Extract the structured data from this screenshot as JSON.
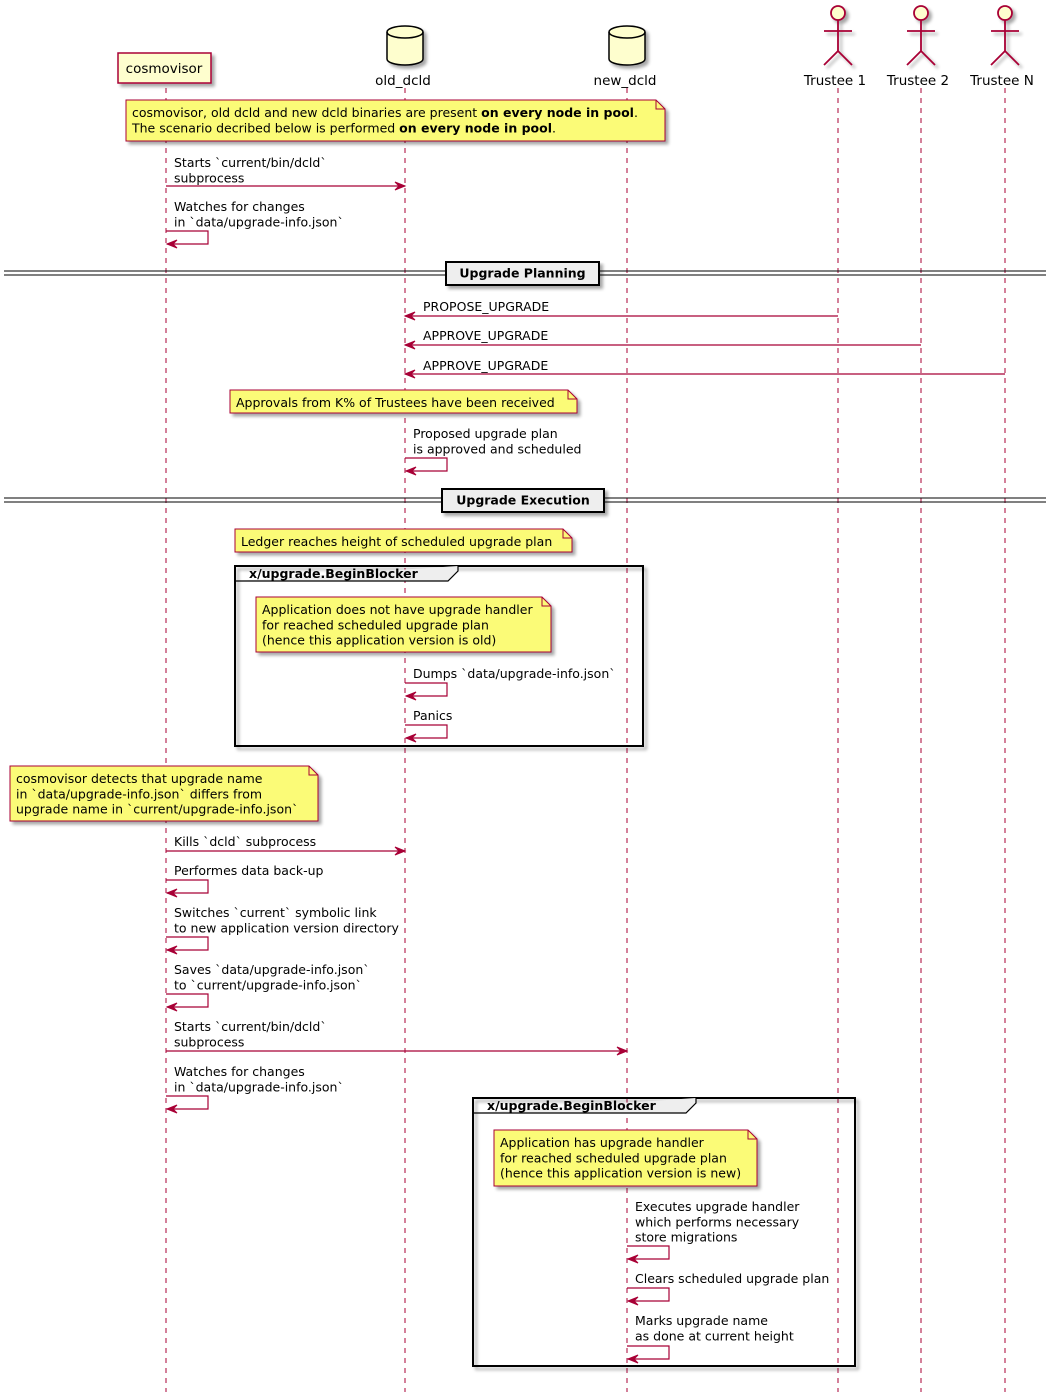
{
  "colors": {
    "line": "#A80036",
    "participant_fill": "#FEFECE",
    "note_fill": "#FBFB77",
    "divider_fill": "#EEEEEE"
  },
  "participants": [
    {
      "label": "cosmovisor",
      "kind": "participant"
    },
    {
      "label": "old_dcld",
      "kind": "database"
    },
    {
      "label": "new_dcld",
      "kind": "database"
    },
    {
      "label": "Trustee 1",
      "kind": "actor"
    },
    {
      "label": "Trustee 2",
      "kind": "actor"
    },
    {
      "label": "Trustee N",
      "kind": "actor"
    }
  ],
  "notes": [
    {
      "lines": [
        [
          {
            "text": "cosmovisor, old dcld and new dcld binaries are present ",
            "bold": false
          },
          {
            "text": "on every node in pool",
            "bold": true
          },
          {
            "text": ".",
            "bold": false
          }
        ],
        [
          {
            "text": "The scenario decribed below is performed ",
            "bold": false
          },
          {
            "text": "on every node in pool",
            "bold": true
          },
          {
            "text": ".",
            "bold": false
          }
        ]
      ]
    },
    {
      "lines": [
        [
          {
            "text": "Approvals from K% of Trustees have been received",
            "bold": false
          }
        ]
      ]
    },
    {
      "lines": [
        [
          {
            "text": "Ledger reaches height of scheduled upgrade plan",
            "bold": false
          }
        ]
      ]
    },
    {
      "lines": [
        [
          {
            "text": "Application does not have upgrade handler",
            "bold": false
          }
        ],
        [
          {
            "text": "for reached scheduled upgrade plan",
            "bold": false
          }
        ],
        [
          {
            "text": "(hence this application version is old)",
            "bold": false
          }
        ]
      ]
    },
    {
      "lines": [
        [
          {
            "text": "cosmovisor detects that upgrade name",
            "bold": false
          }
        ],
        [
          {
            "text": "in `data/upgrade-info.json` differs from",
            "bold": false
          }
        ],
        [
          {
            "text": "upgrade name in `current/upgrade-info.json`",
            "bold": false
          }
        ]
      ]
    },
    {
      "lines": [
        [
          {
            "text": "Application has upgrade handler",
            "bold": false
          }
        ],
        [
          {
            "text": "for reached scheduled upgrade plan",
            "bold": false
          }
        ],
        [
          {
            "text": "(hence this application version is new)",
            "bold": false
          }
        ]
      ]
    }
  ],
  "messages": [
    {
      "from": "cosmovisor",
      "to": "old_dcld",
      "lines": [
        "Starts `current/bin/dcld`",
        "subprocess"
      ]
    },
    {
      "from": "cosmovisor",
      "to": "cosmovisor",
      "lines": [
        "Watches for changes",
        "in `data/upgrade-info.json`"
      ]
    },
    {
      "from": "Trustee 1",
      "to": "old_dcld",
      "lines": [
        "PROPOSE_UPGRADE"
      ]
    },
    {
      "from": "Trustee 2",
      "to": "old_dcld",
      "lines": [
        "APPROVE_UPGRADE"
      ]
    },
    {
      "from": "Trustee N",
      "to": "old_dcld",
      "lines": [
        "APPROVE_UPGRADE"
      ]
    },
    {
      "from": "old_dcld",
      "to": "old_dcld",
      "lines": [
        "Proposed upgrade plan",
        "is approved and scheduled"
      ]
    },
    {
      "from": "old_dcld",
      "to": "old_dcld",
      "lines": [
        "Dumps `data/upgrade-info.json`"
      ]
    },
    {
      "from": "old_dcld",
      "to": "old_dcld",
      "lines": [
        "Panics"
      ]
    },
    {
      "from": "cosmovisor",
      "to": "old_dcld",
      "lines": [
        "Kills `dcld` subprocess"
      ]
    },
    {
      "from": "cosmovisor",
      "to": "cosmovisor",
      "lines": [
        "Performes data back-up"
      ]
    },
    {
      "from": "cosmovisor",
      "to": "cosmovisor",
      "lines": [
        "Switches `current` symbolic link",
        "to new application version directory"
      ]
    },
    {
      "from": "cosmovisor",
      "to": "cosmovisor",
      "lines": [
        "Saves `data/upgrade-info.json`",
        "to `current/upgrade-info.json`"
      ]
    },
    {
      "from": "cosmovisor",
      "to": "new_dcld",
      "lines": [
        "Starts `current/bin/dcld`",
        "subprocess"
      ]
    },
    {
      "from": "cosmovisor",
      "to": "cosmovisor",
      "lines": [
        "Watches for changes",
        "in `data/upgrade-info.json`"
      ]
    },
    {
      "from": "new_dcld",
      "to": "new_dcld",
      "lines": [
        "Executes upgrade handler",
        "which performs necessary",
        "store migrations"
      ]
    },
    {
      "from": "new_dcld",
      "to": "new_dcld",
      "lines": [
        "Clears scheduled upgrade plan"
      ]
    },
    {
      "from": "new_dcld",
      "to": "new_dcld",
      "lines": [
        "Marks upgrade name",
        "as done at current height"
      ]
    }
  ],
  "dividers": [
    {
      "label": "Upgrade Planning"
    },
    {
      "label": "Upgrade Execution"
    }
  ],
  "groups": [
    {
      "label": "x/upgrade.BeginBlocker"
    },
    {
      "label": "x/upgrade.BeginBlocker"
    }
  ]
}
